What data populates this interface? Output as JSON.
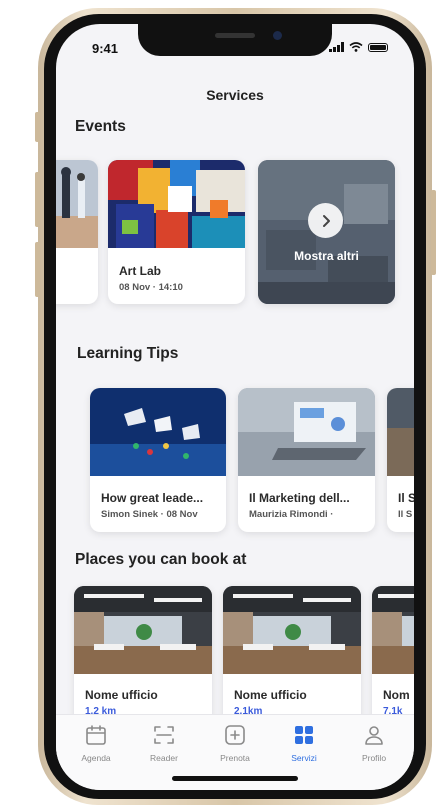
{
  "status_bar": {
    "time": "9:41"
  },
  "header": {
    "title": "Services"
  },
  "events": {
    "title": "Events",
    "cards": [
      {
        "title": "Art Lab",
        "date": "08 Nov · 14:10"
      }
    ],
    "more_label": "Mostra altri"
  },
  "learning_tips": {
    "title": "Learning Tips",
    "cards": [
      {
        "title": "How great leade...",
        "meta": "Simon Sinek · 08 Nov"
      },
      {
        "title": "Il Marketing dell...",
        "meta": "Maurizia Rimondi ·"
      },
      {
        "title": "Il S",
        "meta": "Il S"
      }
    ]
  },
  "places": {
    "title": "Places you can book at",
    "cards": [
      {
        "title": "Nome ufficio",
        "distance": "1,2 km"
      },
      {
        "title": "Nome ufficio",
        "distance": "2,1km"
      },
      {
        "title": "Nom",
        "distance": "7,1k"
      }
    ]
  },
  "tab_bar": {
    "items": [
      {
        "label": "Agenda",
        "icon": "calendar-icon"
      },
      {
        "label": "Reader",
        "icon": "scan-icon"
      },
      {
        "label": "Prenota",
        "icon": "plus-square-icon"
      },
      {
        "label": "Servizi",
        "icon": "grid-icon",
        "active": true
      },
      {
        "label": "Profilo",
        "icon": "user-icon"
      }
    ]
  },
  "colors": {
    "accent": "#2f6fe0",
    "link": "#3b5bdb",
    "background": "#f4f4f7"
  }
}
